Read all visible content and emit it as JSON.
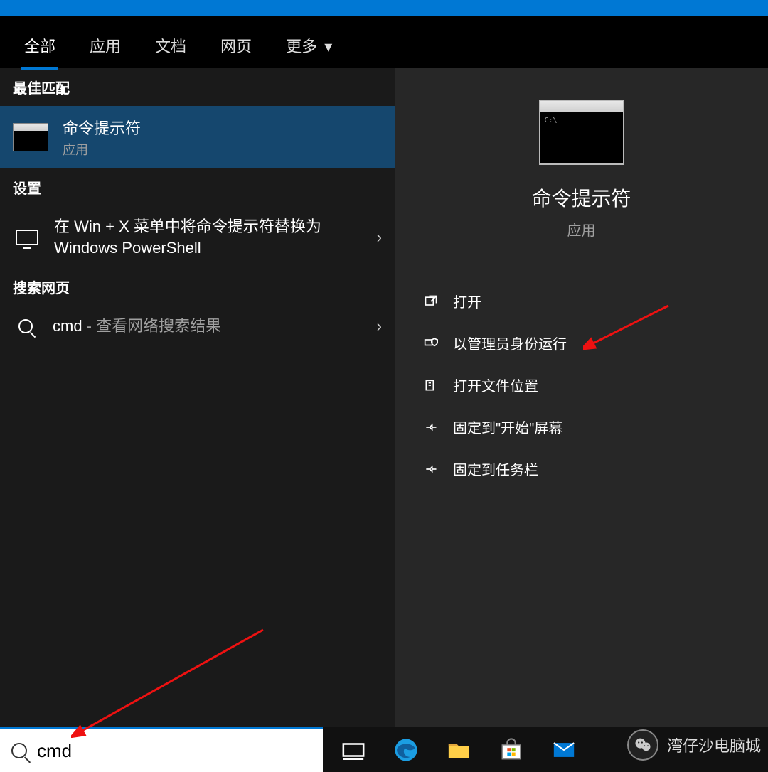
{
  "tabs": [
    {
      "label": "全部",
      "active": true
    },
    {
      "label": "应用"
    },
    {
      "label": "文档"
    },
    {
      "label": "网页"
    },
    {
      "label": "更多",
      "dropdown": true
    }
  ],
  "sections": {
    "best": "最佳匹配",
    "settings": "设置",
    "web": "搜索网页"
  },
  "results": {
    "best": {
      "title": "命令提示符",
      "sub": "应用"
    },
    "settings": {
      "title": "在 Win + X 菜单中将命令提示符替换为 Windows PowerShell"
    },
    "web": {
      "query": "cmd",
      "hint": " - 查看网络搜索结果"
    }
  },
  "preview": {
    "title": "命令提示符",
    "sub": "应用"
  },
  "actions": [
    {
      "label": "打开",
      "icon": "open"
    },
    {
      "label": "以管理员身份运行",
      "icon": "admin"
    },
    {
      "label": "打开文件位置",
      "icon": "folder"
    },
    {
      "label": "固定到\"开始\"屏幕",
      "icon": "pin"
    },
    {
      "label": "固定到任务栏",
      "icon": "pin"
    }
  ],
  "search": {
    "value": "cmd"
  },
  "watermark": "湾仔沙电脑城"
}
